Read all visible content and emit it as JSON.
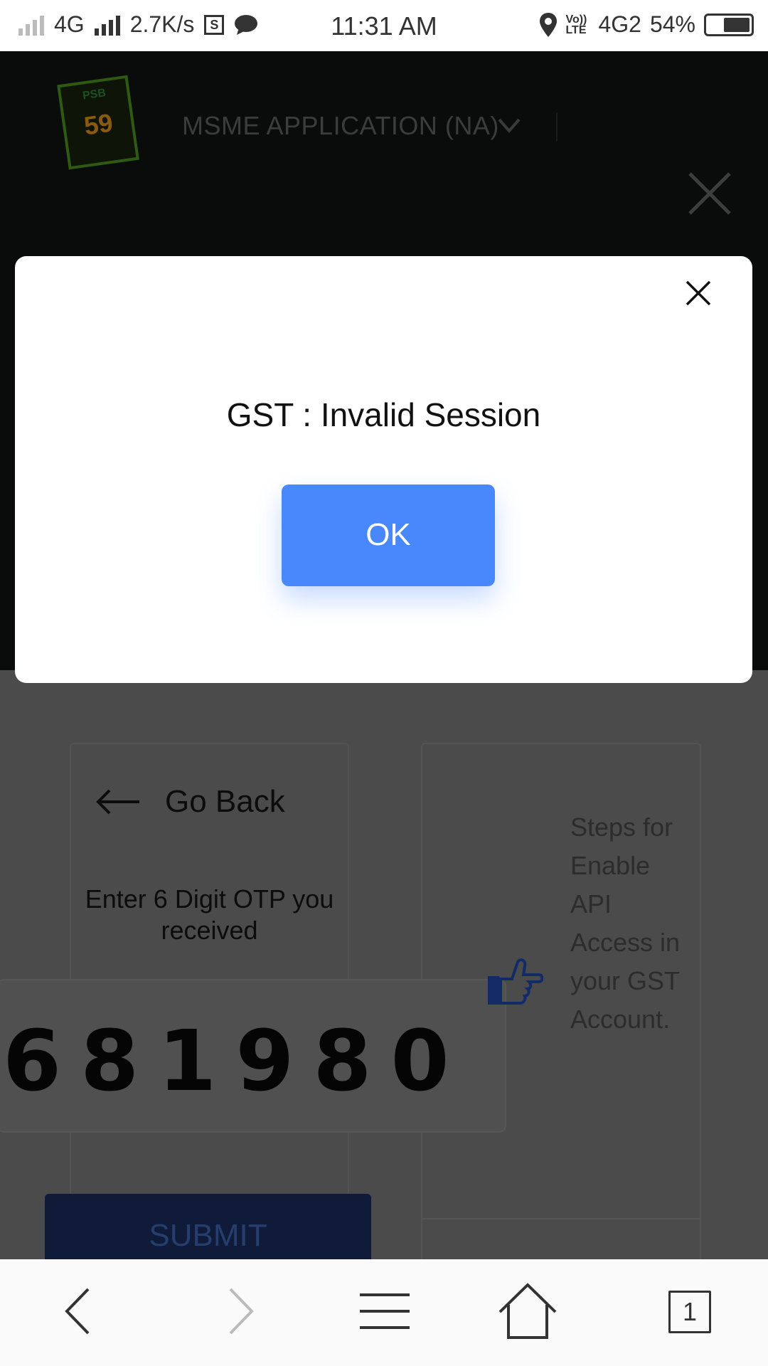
{
  "status_bar": {
    "network_type": "4G",
    "speed": "2.7K/s",
    "sim_label": "S",
    "time": "11:31 AM",
    "volte_label": "Vo)) LTE",
    "network2": "4G2",
    "battery": "54%"
  },
  "header": {
    "logo_text": "59",
    "logo_top": "PSB",
    "application_title": "MSME APPLICATION (NA)"
  },
  "content": {
    "go_back_label": "Go Back",
    "otp_instruction": "Enter 6 Digit OTP you received",
    "otp_value": "681980",
    "submit_label": "SUBMIT",
    "steps_text": "Steps for Enable API Access in your GST Account."
  },
  "modal": {
    "message": "GST : Invalid Session",
    "ok_label": "OK"
  },
  "bottom_bar": {
    "tab_count": "1"
  },
  "colors": {
    "accent": "#4987fd",
    "overlay_dark": "#0a0c0c",
    "content_bg": "#4b4b4b"
  }
}
